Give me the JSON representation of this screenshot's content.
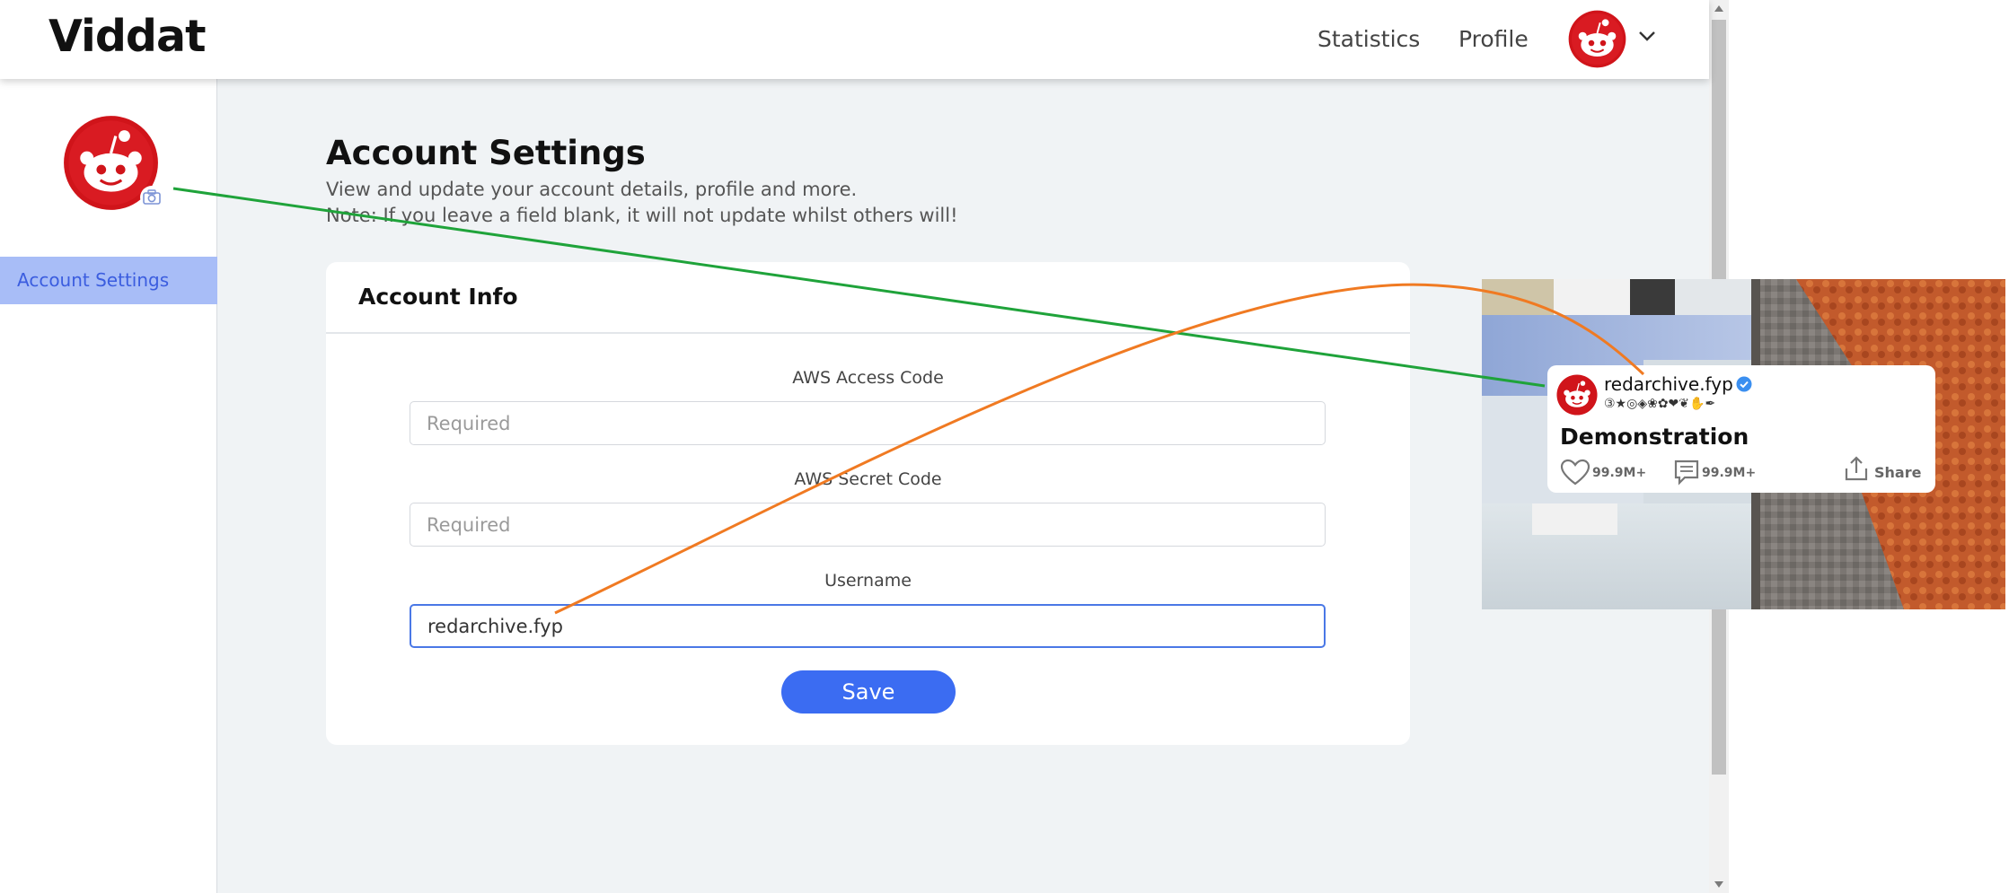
{
  "app": {
    "brand": "Viddat"
  },
  "nav": {
    "statistics": "Statistics",
    "profile": "Profile"
  },
  "sidebar": {
    "items": [
      {
        "label": "Account Settings",
        "active": true
      }
    ]
  },
  "page": {
    "title": "Account Settings",
    "subtitle": "View and update your account details, profile and more.",
    "note": "Note: If you leave a field blank, it will not update whilst others will!"
  },
  "card": {
    "title": "Account Info",
    "fields": [
      {
        "label": "AWS Access Code",
        "value": "",
        "placeholder": "Required"
      },
      {
        "label": "AWS Secret Code",
        "value": "",
        "placeholder": "Required"
      },
      {
        "label": "Username",
        "value": "redarchive.fyp",
        "placeholder": ""
      }
    ],
    "save_label": "Save"
  },
  "preview": {
    "username": "redarchive.fyp",
    "verified": true,
    "badges": "③★◎◈❀✿❤❦✋✒",
    "title": "Demonstration",
    "likes": "99.9M+",
    "comments": "99.9M+",
    "share_label": "Share"
  },
  "colors": {
    "accent": "#3b6cf2",
    "sidebar_active_bg": "#a8bdf7",
    "sidebar_active_text": "#3b5ddf",
    "avatar_red": "#d0141a",
    "annotation_green": "#1fa33a",
    "annotation_orange": "#f07a22"
  },
  "icons": {
    "avatar": "reddit-alien-avatar",
    "dropdown": "chevron-down-icon",
    "camera": "camera-icon",
    "verified": "verified-check-icon",
    "like": "heart-icon",
    "comment": "comment-icon",
    "share": "share-icon"
  }
}
